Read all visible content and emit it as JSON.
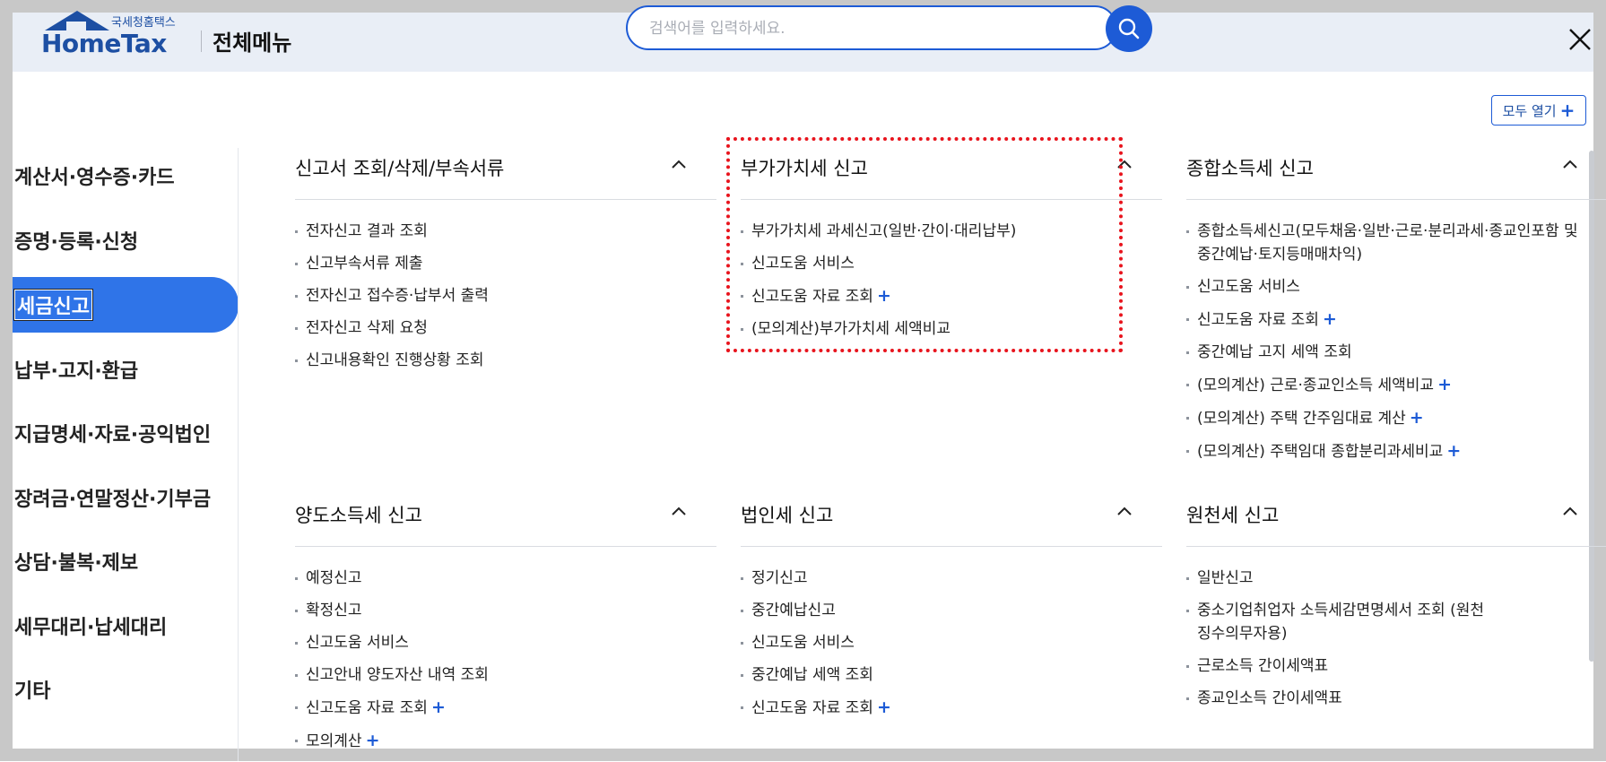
{
  "header": {
    "logo_small": "국세청홈택스",
    "logo_big": "HomeTax",
    "menu_title": "전체메뉴",
    "search_placeholder": "검색어를 입력하세요."
  },
  "open_all_label": "모두 열기",
  "sidebar": {
    "items": [
      {
        "label": "계산서·영수증·카드"
      },
      {
        "label": "증명·등록·신청"
      },
      {
        "label": "세금신고",
        "active": true
      },
      {
        "label": "납부·고지·환급"
      },
      {
        "label": "지급명세·자료·공익법인"
      },
      {
        "label": "장려금·연말정산·기부금"
      },
      {
        "label": "상담·불복·제보"
      },
      {
        "label": "세무대리·납세대리"
      },
      {
        "label": "기타"
      }
    ]
  },
  "sections": [
    {
      "title": "신고서 조회/삭제/부속서류",
      "items": [
        {
          "label": "전자신고 결과 조회"
        },
        {
          "label": "신고부속서류 제출"
        },
        {
          "label": "전자신고 접수증·납부서 출력"
        },
        {
          "label": "전자신고 삭제 요청"
        },
        {
          "label": "신고내용확인 진행상황 조회"
        }
      ]
    },
    {
      "title": "부가가치세 신고",
      "items": [
        {
          "label": "부가가치세 과세신고(일반·간이·대리납부)"
        },
        {
          "label": "신고도움 서비스"
        },
        {
          "label": "신고도움 자료 조회",
          "plus": "+"
        },
        {
          "label": "(모의계산)부가가치세 세액비교"
        }
      ]
    },
    {
      "title": "종합소득세 신고",
      "items": [
        {
          "label": "종합소득세신고(모두채움·일반·근로·분리과세·종교인포함 및 중간예납·토지등매매차익)"
        },
        {
          "label": "신고도움 서비스"
        },
        {
          "label": "신고도움 자료 조회",
          "plus": "+"
        },
        {
          "label": "중간예납 고지 세액 조회"
        },
        {
          "label": "(모의계산) 근로·종교인소득 세액비교",
          "plus": "+"
        },
        {
          "label": "(모의계산) 주택 간주임대료 계산",
          "plus": "+"
        },
        {
          "label": "(모의계산) 주택임대 종합분리과세비교",
          "plus": "+"
        }
      ]
    },
    {
      "title": "양도소득세 신고",
      "items": [
        {
          "label": "예정신고"
        },
        {
          "label": "확정신고"
        },
        {
          "label": "신고도움 서비스"
        },
        {
          "label": "신고안내 양도자산 내역 조회"
        },
        {
          "label": "신고도움 자료 조회",
          "plus": "+"
        },
        {
          "label": "모의계산",
          "plus": "+"
        }
      ]
    },
    {
      "title": "법인세 신고",
      "items": [
        {
          "label": "정기신고"
        },
        {
          "label": "중간예납신고"
        },
        {
          "label": "신고도움 서비스"
        },
        {
          "label": "중간예납 세액 조회"
        },
        {
          "label": "신고도움 자료 조회",
          "plus": "+"
        }
      ]
    },
    {
      "title": "원천세 신고",
      "items": [
        {
          "label": "일반신고"
        },
        {
          "label": "중소기업취업자 소득세감면명세서 조회 (원천징수의무자용)"
        },
        {
          "label": "근로소득 간이세액표"
        },
        {
          "label": "종교인소득 간이세액표"
        }
      ]
    }
  ],
  "colors": {
    "accent": "#1d5bd6",
    "active_bg": "#2f74e8",
    "highlight_border": "#e8141d"
  }
}
